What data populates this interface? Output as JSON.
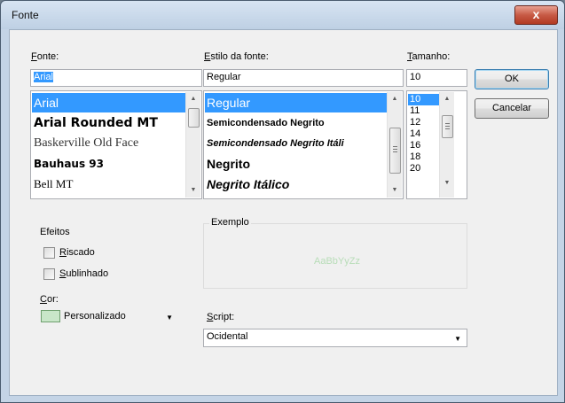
{
  "window": {
    "title": "Fonte",
    "close_glyph": "x"
  },
  "font": {
    "label": "Fonte:",
    "label_hotkey": "F",
    "label_rest": "onte:",
    "value": "Arial",
    "items": [
      {
        "label": "Arial",
        "selected": true
      },
      {
        "label": "Arial Rounded MT",
        "selected": false
      },
      {
        "label": "Baskerville Old Face",
        "selected": false
      },
      {
        "label": "Bauhaus 93",
        "selected": false
      },
      {
        "label": "Bell MT",
        "selected": false
      }
    ]
  },
  "style": {
    "label_hotkey": "E",
    "label_rest": "stilo da fonte:",
    "value": "Regular",
    "items": [
      {
        "label": "Regular",
        "selected": true
      },
      {
        "label": "Semicondensado Negrito",
        "selected": false
      },
      {
        "label": "Semicondensado Negrito Itáli",
        "selected": false
      },
      {
        "label": "Negrito",
        "selected": false
      },
      {
        "label": "Negrito Itálico",
        "selected": false
      }
    ]
  },
  "size": {
    "label_hotkey": "T",
    "label_rest": "amanho:",
    "value": "10",
    "items": [
      "10",
      "11",
      "12",
      "14",
      "16",
      "18",
      "20"
    ]
  },
  "buttons": {
    "ok": "OK",
    "cancel": "Cancelar"
  },
  "effects": {
    "title": "Efeitos",
    "strike_hotkey": "R",
    "strike_rest": "iscado",
    "underline_hotkey": "S",
    "underline_rest": "ublinhado",
    "strike_checked": false,
    "underline_checked": false
  },
  "color": {
    "label_hotkey": "C",
    "label_rest": "or:",
    "value": "Personalizado",
    "swatch": "#c9e6c9"
  },
  "sample": {
    "title": "Exemplo",
    "text": "AaBbYyZz"
  },
  "script": {
    "label_hotkey": "S",
    "label_rest": "cript:",
    "value": "Ocidental"
  }
}
